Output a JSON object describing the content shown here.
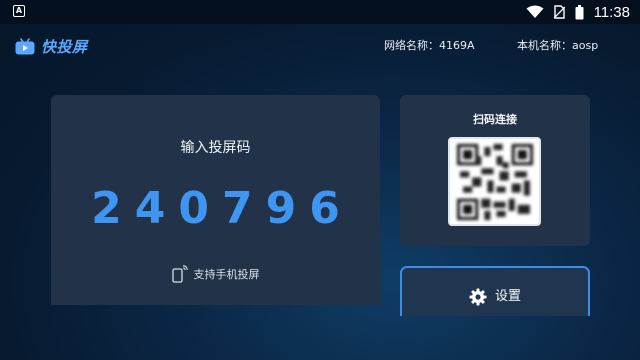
{
  "status_bar": {
    "time": "11:38",
    "left_icon": "A",
    "icons": [
      "wifi-icon",
      "no-sim-icon",
      "battery-icon"
    ]
  },
  "header": {
    "app_name": "快投屏",
    "network_label": "网络名称：4169A",
    "device_label": "本机名称：aosp"
  },
  "code_card": {
    "title": "输入投屏码",
    "code": "240796",
    "hint": "支持手机投屏"
  },
  "qr_card": {
    "title": "扫码连接"
  },
  "settings": {
    "label": "设置"
  },
  "colors": {
    "accent": "#3f95f2",
    "logo": "#5aa8ff",
    "card": "#223349",
    "button_border": "#3d8de6"
  }
}
